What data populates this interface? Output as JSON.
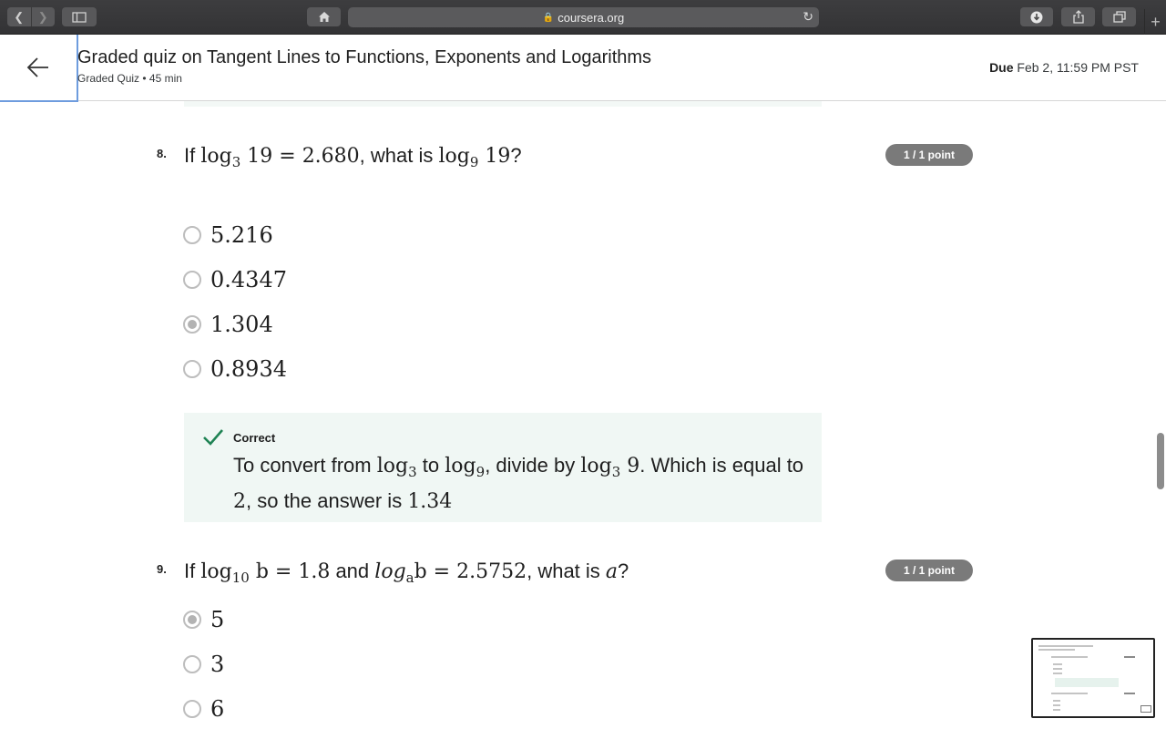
{
  "browser": {
    "url": "coursera.org"
  },
  "header": {
    "title": "Graded quiz on Tangent Lines to Functions, Exponents and Logarithms",
    "subtitle": "Graded Quiz • 45 min",
    "due_label": "Due",
    "due_value": "Feb 2, 11:59 PM PST"
  },
  "questions": [
    {
      "number": "8.",
      "prefix": "If",
      "math1_base": "log",
      "math1_sub": "3",
      "math1_rest": " 19 = 2.680",
      "middle": ", what is",
      "math2_base": "log",
      "math2_sub": "9",
      "math2_rest": " 19",
      "suffix": "?",
      "points": "1 / 1 point",
      "options": [
        {
          "label": "5.216",
          "selected": false
        },
        {
          "label": "0.4347",
          "selected": false
        },
        {
          "label": "1.304",
          "selected": true
        },
        {
          "label": "0.8934",
          "selected": false
        }
      ],
      "feedback": {
        "title": "Correct",
        "t1": "To convert from",
        "m1": "log",
        "m1_sub": "3",
        "t2": "to",
        "m2": "log",
        "m2_sub": "9",
        "t3": ", divide by",
        "m3": "log",
        "m3_sub": "3",
        "m3_rest": " 9",
        "t4": ". Which is equal to",
        "m4": "2",
        "t5": ", so the answer is",
        "m5": "1.34"
      }
    },
    {
      "number": "9.",
      "prefix": "If",
      "math1_base": "log",
      "math1_sub": "10",
      "math1_rest": " b = 1.8",
      "middle": "and",
      "math2_base": "log",
      "math2_sub": "a",
      "math2_rest": "b = 2.5752",
      "tail": ", what is",
      "math3": "a",
      "suffix": "?",
      "points": "1 / 1 point",
      "options": [
        {
          "label": "5",
          "selected": true
        },
        {
          "label": "3",
          "selected": false
        },
        {
          "label": "6",
          "selected": false
        }
      ]
    }
  ]
}
